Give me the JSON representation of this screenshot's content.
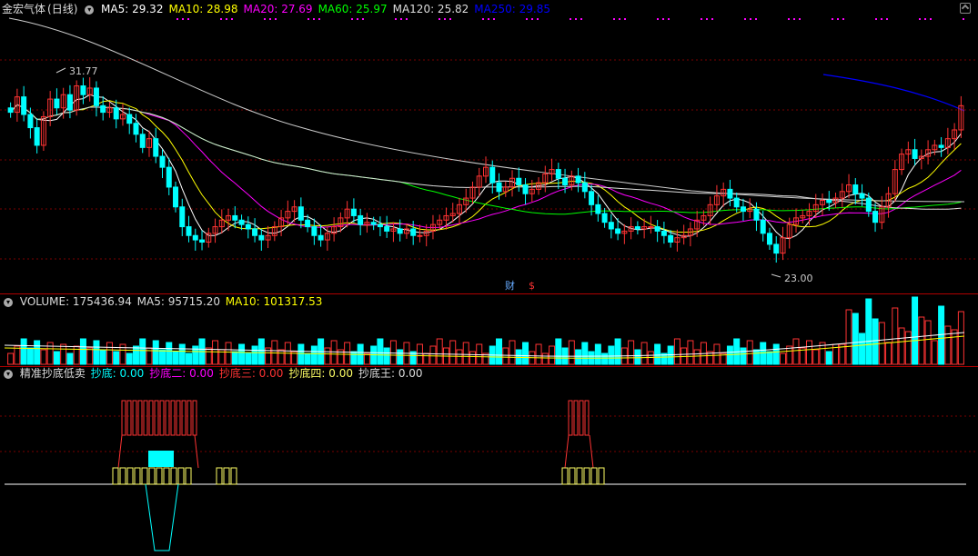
{
  "main": {
    "title": "金宏气体",
    "period": "(日线)",
    "ma_labels": [
      {
        "text": "MA5: 29.32",
        "color": "#ffffff"
      },
      {
        "text": "MA10: 28.98",
        "color": "#ffff00"
      },
      {
        "text": "MA20: 27.69",
        "color": "#ff00ff"
      },
      {
        "text": "MA60: 25.97",
        "color": "#00ff00"
      },
      {
        "text": "MA120: 25.82",
        "color": "#dddddd"
      },
      {
        "text": "MA250: 29.85",
        "color": "#0000ff"
      }
    ],
    "high_label": "31.77",
    "low_label": "23.00",
    "markers": [
      {
        "text": "财",
        "color": "#66aaff"
      },
      {
        "text": "$",
        "color": "#ff3333"
      }
    ]
  },
  "volume": {
    "label": "VOLUME: 175436.94",
    "ma5": "MA5: 95715.20",
    "ma10": "MA10: 101317.53"
  },
  "indicator": {
    "title": "精准抄底低卖",
    "labels": [
      {
        "text": "抄底: 0.00",
        "color": "#00ffff"
      },
      {
        "text": "抄底二: 0.00",
        "color": "#ff00ff"
      },
      {
        "text": "抄底三: 0.00",
        "color": "#ff3333"
      },
      {
        "text": "抄底四: 0.00",
        "color": "#ffff66"
      },
      {
        "text": "抄底王: 0.00",
        "color": "#dddddd"
      }
    ]
  },
  "colors": {
    "up": "#ff3333",
    "down": "#00ffff",
    "grid": "#7a0000",
    "ma5": "#ffffff",
    "ma10": "#ffff00",
    "ma20": "#ff00ff",
    "ma60": "#00ff00",
    "ma120": "#dddddd",
    "ma250": "#0000ff"
  },
  "chart_data": {
    "type": "candlestick",
    "price_high": 31.77,
    "price_low": 23.0,
    "closes": [
      30.1,
      30.8,
      30.0,
      29.4,
      28.6,
      29.9,
      30.7,
      30.3,
      30.9,
      30.2,
      31.3,
      30.9,
      31.2,
      30.4,
      30.1,
      30.3,
      29.8,
      30.0,
      29.6,
      29.1,
      28.5,
      28.9,
      28.1,
      27.6,
      26.7,
      25.8,
      24.9,
      24.5,
      24.3,
      24.2,
      24.6,
      24.9,
      25.2,
      25.4,
      25.2,
      25.0,
      24.8,
      24.5,
      24.3,
      24.5,
      24.9,
      25.3,
      25.6,
      25.8,
      25.2,
      24.9,
      24.5,
      24.3,
      24.6,
      24.9,
      25.3,
      25.7,
      25.4,
      25.0,
      25.1,
      25.0,
      24.9,
      24.7,
      24.8,
      24.6,
      24.8,
      24.5,
      24.5,
      24.7,
      25.0,
      25.2,
      25.4,
      25.5,
      25.9,
      26.2,
      26.7,
      27.2,
      27.6,
      26.9,
      26.5,
      26.7,
      27.1,
      26.8,
      26.4,
      26.6,
      26.9,
      27.3,
      27.5,
      27.1,
      26.8,
      27.2,
      26.9,
      26.5,
      25.9,
      25.5,
      25.1,
      24.8,
      24.6,
      24.7,
      24.9,
      24.8,
      24.9,
      24.9,
      24.7,
      24.5,
      24.2,
      24.4,
      24.5,
      24.8,
      25.2,
      25.4,
      25.9,
      26.3,
      26.6,
      26.2,
      25.8,
      25.6,
      25.7,
      25.2,
      24.6,
      24.1,
      23.7,
      24.4,
      25.0,
      25.3,
      25.4,
      25.6,
      25.9,
      26.1,
      26.0,
      26.2,
      26.5,
      26.8,
      26.4,
      26.2,
      25.6,
      25.1,
      25.8,
      26.4,
      27.5,
      28.2,
      28.4,
      28.0,
      28.1,
      28.4,
      28.6,
      28.5,
      28.9,
      29.3,
      30.4
    ]
  }
}
